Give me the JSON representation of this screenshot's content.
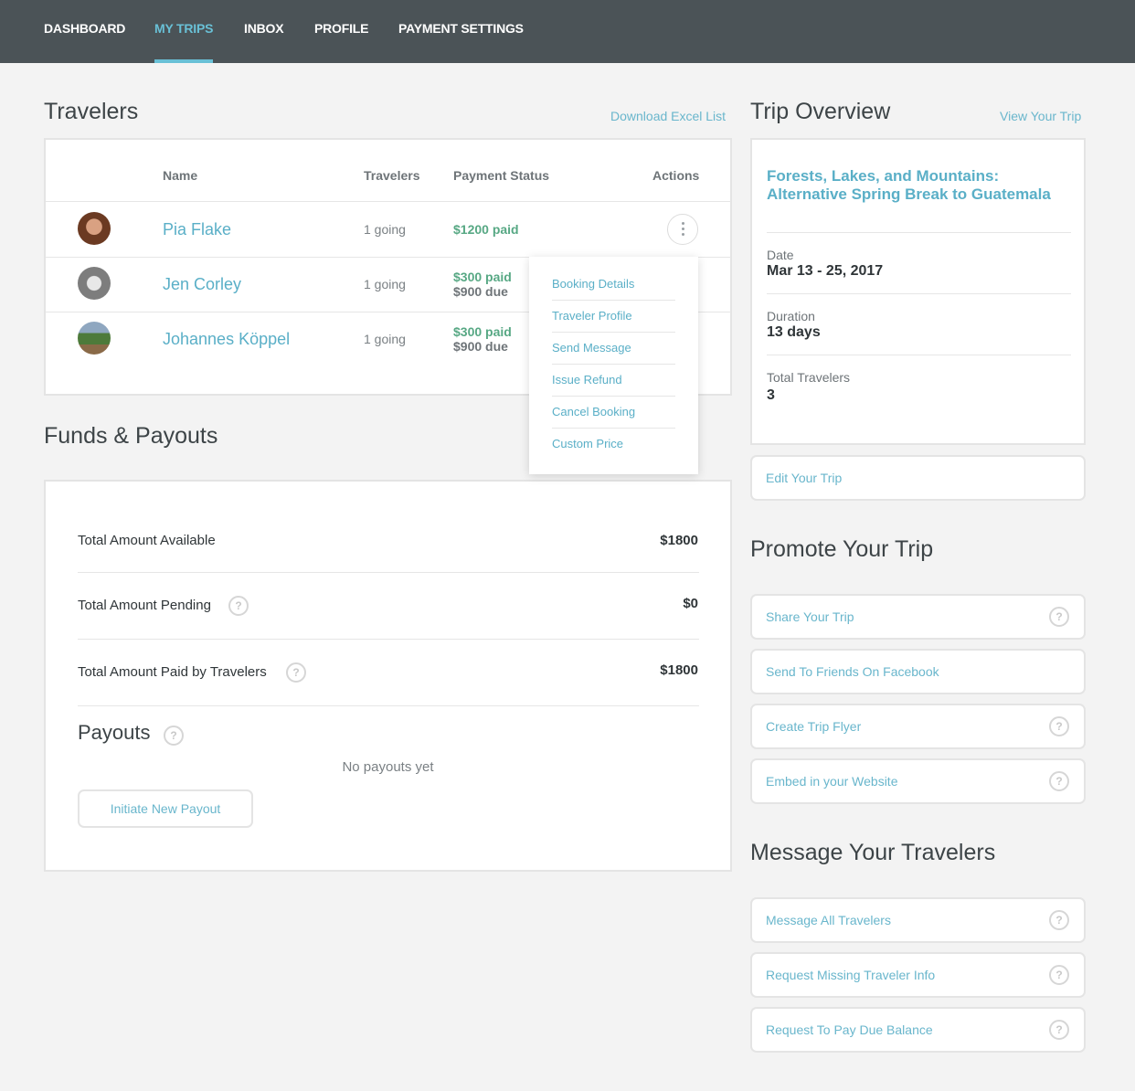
{
  "nav": {
    "items": [
      {
        "label": "DASHBOARD"
      },
      {
        "label": "MY TRIPS",
        "active": true
      },
      {
        "label": "INBOX"
      },
      {
        "label": "PROFILE"
      },
      {
        "label": "PAYMENT SETTINGS"
      }
    ]
  },
  "travelers": {
    "title": "Travelers",
    "download_link": "Download Excel List",
    "columns": [
      "Name",
      "Travelers",
      "Payment Status",
      "Actions"
    ],
    "rows": [
      {
        "name": "Pia Flake",
        "travelers": "1 going",
        "paid": "$1200 paid",
        "due": ""
      },
      {
        "name": "Jen Corley",
        "travelers": "1 going",
        "paid": "$300 paid",
        "due": "$900 due"
      },
      {
        "name": "Johannes Köppel",
        "travelers": "1 going",
        "paid": "$300 paid",
        "due": "$900 due"
      }
    ],
    "actions_menu": [
      "Booking Details",
      "Traveler Profile",
      "Send Message",
      "Issue Refund",
      "Cancel Booking",
      "Custom Price"
    ]
  },
  "funds": {
    "title": "Funds & Payouts",
    "total_available_label": "Total Amount Available",
    "total_available_value": "$1800",
    "total_pending_label": "Total Amount Pending",
    "total_pending_value": "$0",
    "total_paid_label": "Total Amount Paid by Travelers",
    "total_paid_value": "$1800",
    "payouts_title": "Payouts",
    "no_payouts": "No payouts yet",
    "initiate_button": "Initiate New Payout"
  },
  "overview": {
    "title": "Trip Overview",
    "view_link": "View Your Trip",
    "trip_name": "Forests, Lakes, and Mountains: Alternative Spring Break to Guatemala",
    "date_label": "Date",
    "date_value": "Mar 13 - 25, 2017",
    "duration_label": "Duration",
    "duration_value": "13 days",
    "total_travelers_label": "Total Travelers",
    "total_travelers_value": "3",
    "edit_button": "Edit Your Trip"
  },
  "promote": {
    "title": "Promote Your Trip",
    "buttons": [
      "Share Your Trip",
      "Send To Friends On Facebook",
      "Create Trip Flyer",
      "Embed in your Website"
    ]
  },
  "message": {
    "title": "Message Your Travelers",
    "buttons": [
      "Message All Travelers",
      "Request Missing Traveler Info",
      "Request To Pay Due Balance"
    ]
  },
  "help_glyph": "?",
  "colors": {
    "nav_bg": "#4b5357",
    "accent": "#69c0d6",
    "paid_green": "#57a884",
    "page_bg": "#f3f3f3"
  }
}
